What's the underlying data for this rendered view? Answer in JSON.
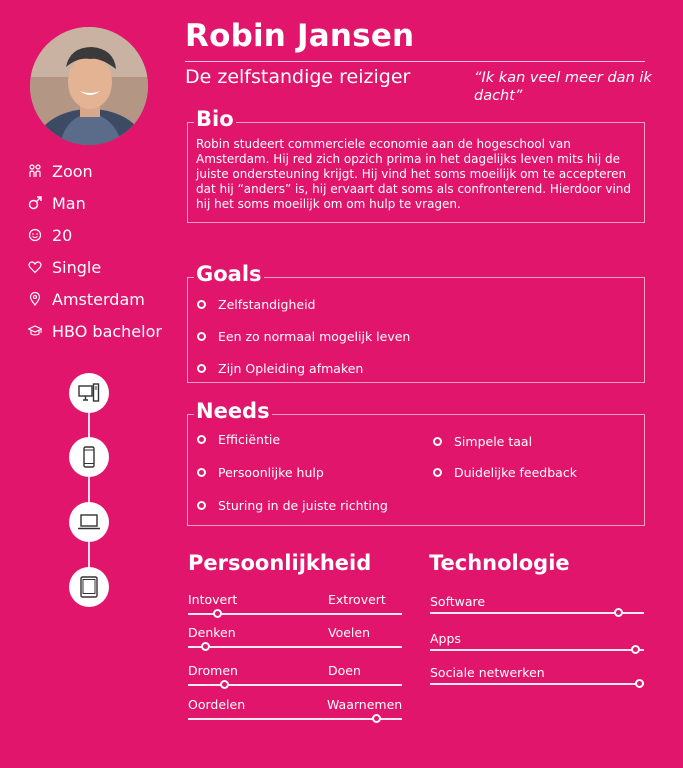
{
  "persona": {
    "name": "Robin Jansen",
    "subtitle": "De zelfstandige reiziger",
    "quote": "“Ik kan veel meer dan ik dacht”"
  },
  "attributes": [
    {
      "icon": "family-icon",
      "label": "Zoon"
    },
    {
      "icon": "male-icon",
      "label": "Man"
    },
    {
      "icon": "age-icon",
      "label": "20"
    },
    {
      "icon": "heart-icon",
      "label": "Single"
    },
    {
      "icon": "location-pin-icon",
      "label": "Amsterdam"
    },
    {
      "icon": "graduation-cap-icon",
      "label": "HBO bachelor"
    }
  ],
  "devices": [
    "desktop-icon",
    "smartphone-icon",
    "laptop-icon",
    "tablet-icon"
  ],
  "bio": {
    "title": "Bio",
    "text": "Robin studeert commerciele economie aan de hogeschool van Amsterdam. Hij red zich opzich prima in het dagelijks leven mits hij de juiste ondersteuning krijgt. Hij vind het soms moeilijk om te accepteren dat hij “anders” is, hij ervaart dat soms als confronterend. Hierdoor vind hij het soms moeilijk om om hulp te vragen."
  },
  "goals": {
    "title": "Goals",
    "items": [
      "Zelfstandigheid",
      "Een zo normaal mogelijk leven",
      "Zijn Opleiding afmaken"
    ]
  },
  "needs": {
    "title": "Needs",
    "left": [
      "Efficiëntie",
      "Persoonlijke hulp",
      "Sturing in de juiste richting"
    ],
    "right": [
      "Simpele taal",
      "Duidelijke feedback"
    ]
  },
  "personality": {
    "title": "Persoonlijkheid",
    "scales": [
      {
        "left": "Intovert",
        "right": "Extrovert",
        "value": 0.14
      },
      {
        "left": "Denken",
        "right": "Voelen",
        "value": 0.08
      },
      {
        "left": "Dromen",
        "right": "Doen",
        "value": 0.17
      },
      {
        "left": "Oordelen",
        "right": "Waarnemen",
        "value": 0.88
      }
    ]
  },
  "technology": {
    "title": "Technologie",
    "scales": [
      {
        "label": "Software",
        "value": 0.88
      },
      {
        "label": "Apps",
        "value": 0.96
      },
      {
        "label": "Sociale netwerken",
        "value": 0.98
      }
    ]
  },
  "colors": {
    "background": "#e0156b",
    "foreground": "#ffffff"
  }
}
